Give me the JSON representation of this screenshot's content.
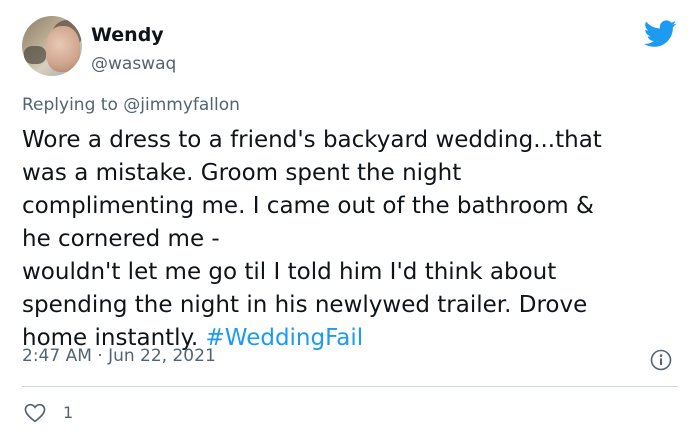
{
  "author": {
    "display_name": "Wendy",
    "handle": "@waswaq"
  },
  "reply": {
    "prefix": "Replying to ",
    "mention": "@jimmyfallon"
  },
  "tweet": {
    "text": "Wore a dress to a friend's backyard wedding...that\nwas a mistake. Groom spent the night\ncomplimenting me. I came out of the bathroom &\nhe cornered me -\nwouldn't let me go til I told him I'd think about\nspending the night in his newlywed trailer. Drove\nhome instantly. ",
    "hashtag": "#WeddingFail",
    "timestamp": "2:47 AM · Jun 22, 2021"
  },
  "engagement": {
    "likes": "1"
  },
  "colors": {
    "text": "#0f1419",
    "secondary": "#536471",
    "accent": "#1d9bf0",
    "divider": "#cfd9de"
  },
  "icons": {
    "brand": "twitter-bird-icon",
    "info": "info-icon",
    "like": "heart-icon"
  }
}
